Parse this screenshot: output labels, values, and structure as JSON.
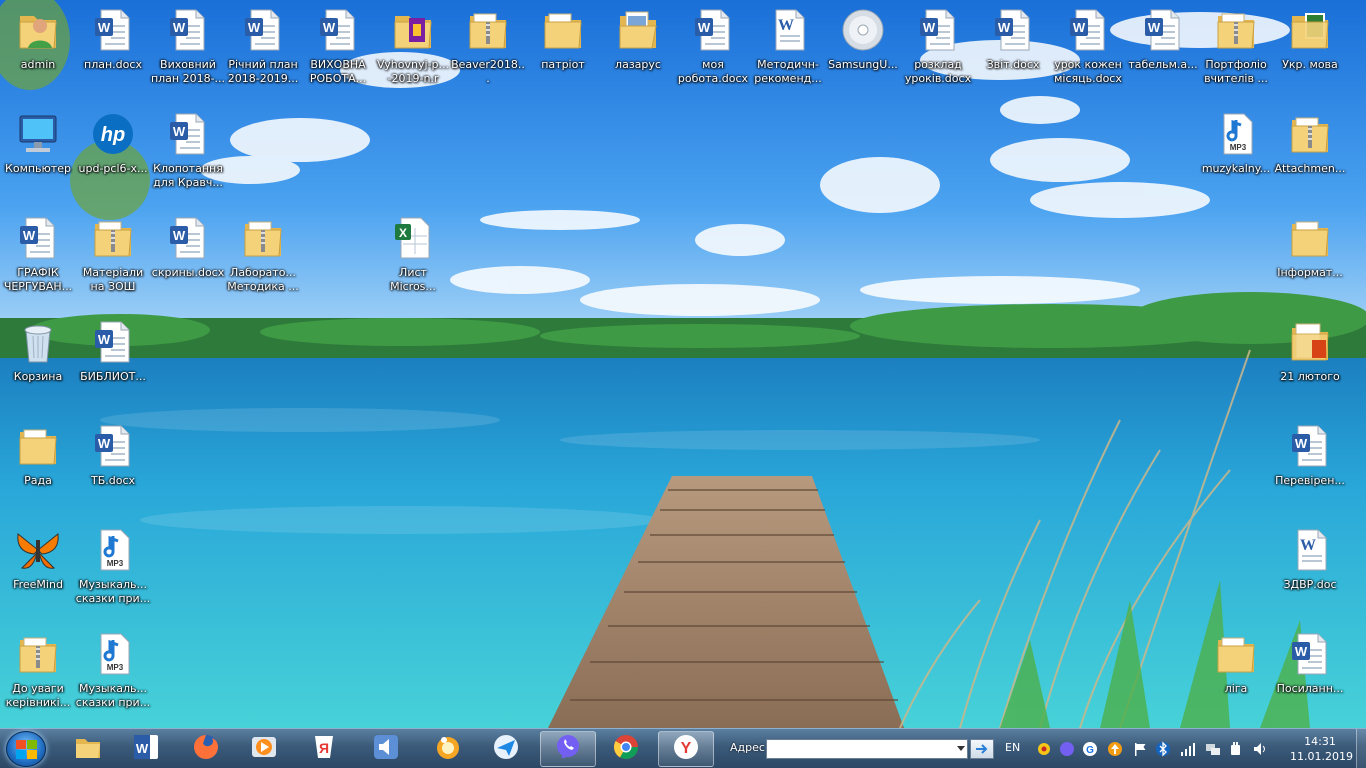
{
  "desktop": {
    "icons": [
      {
        "id": "admin",
        "type": "user",
        "label": "admin"
      },
      {
        "id": "plan",
        "type": "word",
        "label": "план.docx"
      },
      {
        "id": "vykhovnyi",
        "type": "word",
        "label": "Виховний\nплан 2018-..."
      },
      {
        "id": "richnyi",
        "type": "word",
        "label": "Річний план\n2018-2019..."
      },
      {
        "id": "vykhovna",
        "type": "word",
        "label": "ВИХОВНА\nРОБОТА..."
      },
      {
        "id": "vyhovnyj",
        "type": "rar",
        "label": "Vyhovnyj-p...\n-2019-n.r"
      },
      {
        "id": "beaver",
        "type": "zip-folder",
        "label": "Beaver2018..."
      },
      {
        "id": "patriot",
        "type": "folder",
        "label": "патріот"
      },
      {
        "id": "lazarus",
        "type": "folder-open",
        "label": "лазарус"
      },
      {
        "id": "moya",
        "type": "word",
        "label": "моя\nробота.docx"
      },
      {
        "id": "metodychni",
        "type": "word-doc",
        "label": "Методичн-\nрекоменд..."
      },
      {
        "id": "samsung",
        "type": "cd",
        "label": "SamsungU..."
      },
      {
        "id": "rozklad",
        "type": "word",
        "label": "розклад\nуроків.docx"
      },
      {
        "id": "zvit",
        "type": "word",
        "label": "Звіт.docx"
      },
      {
        "id": "urok",
        "type": "word",
        "label": "урок кожен\nмісяць.docx"
      },
      {
        "id": "tabel",
        "type": "word",
        "label": "табельм.а..."
      },
      {
        "id": "portfolio",
        "type": "zip-folder",
        "label": "Портфоліо\nвчителів ..."
      },
      {
        "id": "ukr",
        "type": "folder-image",
        "label": "Укр. мова"
      },
      {
        "id": "computer",
        "type": "computer",
        "label": "Компьютер"
      },
      {
        "id": "upd",
        "type": "hp",
        "label": "upd-pcl6-x..."
      },
      {
        "id": "klopotannia",
        "type": "word",
        "label": "Клопотання\nдля Кравч..."
      },
      {
        "id": "muzykalny",
        "type": "mp3",
        "label": "muzykalny..."
      },
      {
        "id": "attachments",
        "type": "zip-folder",
        "label": "Attachmen..."
      },
      {
        "id": "grafik",
        "type": "word",
        "label": "ГРАФІК\nЧЕРГУВАН..."
      },
      {
        "id": "materialy",
        "type": "zip-folder",
        "label": "Матеріали\nна ЗОШ"
      },
      {
        "id": "skryny",
        "type": "word",
        "label": "скрины.docx"
      },
      {
        "id": "laboratoria",
        "type": "zip-folder",
        "label": "Лаборато...\nМетодика ..."
      },
      {
        "id": "lyst",
        "type": "excel",
        "label": "Лист\nMicros..."
      },
      {
        "id": "informat",
        "type": "folder",
        "label": "Інформат..."
      },
      {
        "id": "korzyna",
        "type": "recycle",
        "label": "Корзина"
      },
      {
        "id": "bibliot",
        "type": "word",
        "label": "БИБЛИОТ..."
      },
      {
        "id": "lyutoho",
        "type": "folder-doc",
        "label": "21 лютого"
      },
      {
        "id": "rada",
        "type": "folder",
        "label": "Рада"
      },
      {
        "id": "tb",
        "type": "word",
        "label": "ТБ.docx"
      },
      {
        "id": "perevir",
        "type": "word",
        "label": "Перевірен..."
      },
      {
        "id": "freemind",
        "type": "freemind",
        "label": "FreeMind"
      },
      {
        "id": "muzykal1",
        "type": "mp3",
        "label": "Музыкаль...\nсказки при..."
      },
      {
        "id": "zdvr",
        "type": "word-doc",
        "label": "ЗДВР.doc"
      },
      {
        "id": "douvagy",
        "type": "zip-folder",
        "label": "До уваги\nкерівникі..."
      },
      {
        "id": "muzykal2",
        "type": "mp3",
        "label": "Музыкаль...\nсказки при..."
      },
      {
        "id": "liga",
        "type": "folder",
        "label": "ліга"
      },
      {
        "id": "posylann",
        "type": "word",
        "label": "Посиланн..."
      }
    ]
  },
  "taskbar": {
    "start_icon": "windows-orb-icon",
    "apps": [
      {
        "id": "explorer",
        "icon": "folder-icon",
        "active": false
      },
      {
        "id": "word",
        "icon": "word-icon",
        "active": false
      },
      {
        "id": "firefox",
        "icon": "firefox-icon",
        "active": false
      },
      {
        "id": "media",
        "icon": "media-player-icon",
        "active": false
      },
      {
        "id": "yandex-browser",
        "icon": "yandex-browser-icon",
        "active": false
      },
      {
        "id": "speaker",
        "icon": "speaker-app-icon",
        "active": false
      },
      {
        "id": "orange",
        "icon": "orange-app-icon",
        "active": false
      },
      {
        "id": "send",
        "icon": "send-app-icon",
        "active": false
      },
      {
        "id": "viber",
        "icon": "viber-icon",
        "active": true
      },
      {
        "id": "chrome",
        "icon": "chrome-icon",
        "active": false
      },
      {
        "id": "yandex",
        "icon": "yandex-icon",
        "active": true
      }
    ],
    "address_label": "Адрес",
    "address_value": "",
    "language": "EN",
    "tray": [
      "flower-icon",
      "viber-tray-icon",
      "g-icon",
      "update-icon",
      "flag-icon",
      "bluetooth-icon",
      "signal-icon",
      "network-icon",
      "power-icon",
      "volume-icon"
    ],
    "time": "14:31",
    "date": "11.01.2019"
  },
  "colors": {
    "taskbar": "#3b5a79",
    "sky": "#2f86e8",
    "water": "#22b6d8",
    "word_blue": "#2a5ca8",
    "folder_yellow": "#f3d27a"
  }
}
